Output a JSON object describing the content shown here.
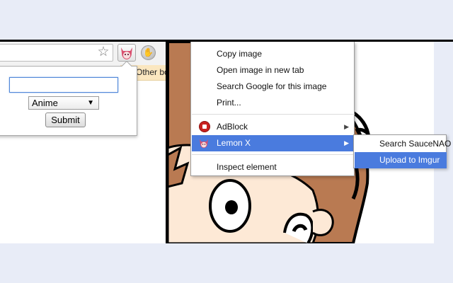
{
  "browser": {
    "bookmarks_label": "Other bo",
    "icons": {
      "star": "star-icon",
      "extension": "lemonx-anime-girl-icon",
      "hand": "hand-icon"
    }
  },
  "popup": {
    "query_value": "",
    "category_selected": "Anime",
    "submit_label": "Submit"
  },
  "context_menu": {
    "items": [
      {
        "label": "Copy image"
      },
      {
        "label": "Open image in new tab"
      },
      {
        "label": "Search Google for this image"
      },
      {
        "label": "Print..."
      },
      {
        "label": "AdBlock",
        "icon": "adblock-icon",
        "has_submenu": true
      },
      {
        "label": "Lemon X",
        "icon": "lemonx-anime-girl-icon",
        "has_submenu": true,
        "highlighted": true
      },
      {
        "label": "Inspect element"
      }
    ]
  },
  "submenu": {
    "items": [
      {
        "label": "Search SauceNAO"
      },
      {
        "label": "Upload to Imgur",
        "highlighted": true
      }
    ]
  },
  "colors": {
    "highlight": "#4a7bde",
    "page_background": "#e8ecf7",
    "bookmark_bar": "#fbe7c0",
    "skin": "#b97a52"
  }
}
